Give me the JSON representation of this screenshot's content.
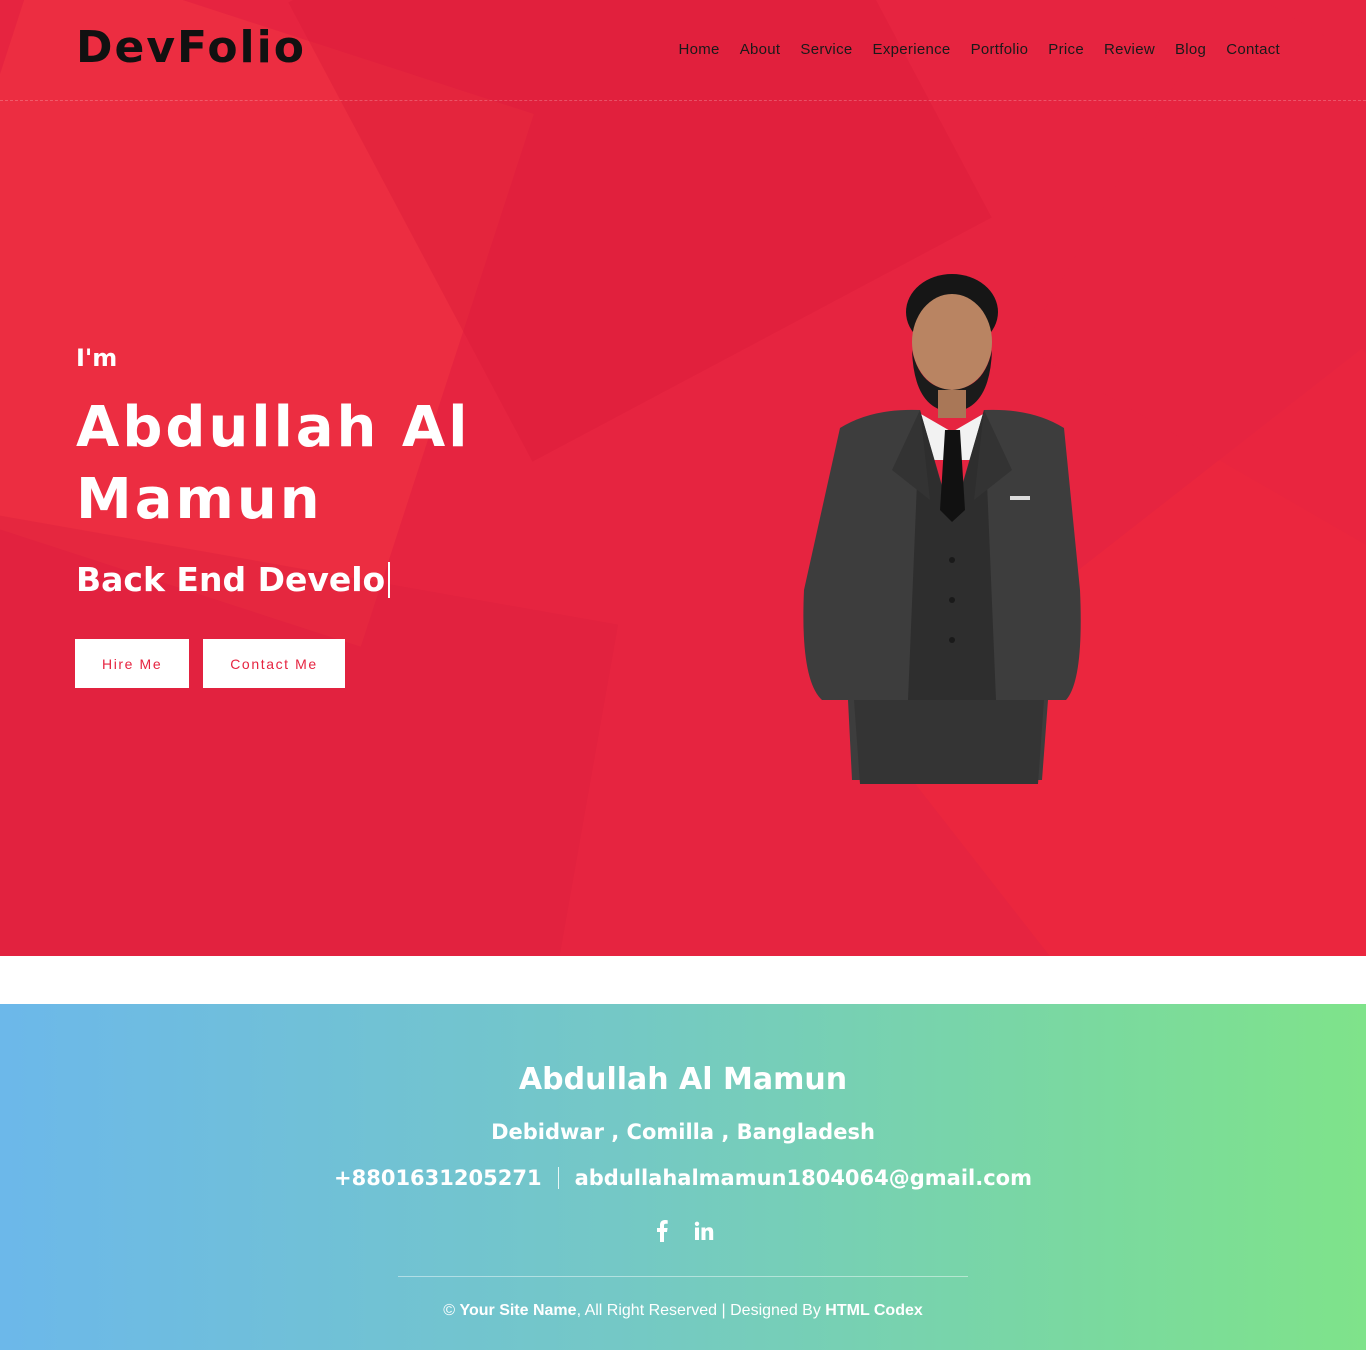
{
  "brand": {
    "logo": "DevFolio"
  },
  "nav": {
    "items": [
      {
        "label": "Home"
      },
      {
        "label": "About"
      },
      {
        "label": "Service"
      },
      {
        "label": "Experience"
      },
      {
        "label": "Portfolio"
      },
      {
        "label": "Price"
      },
      {
        "label": "Review"
      },
      {
        "label": "Blog"
      },
      {
        "label": "Contact"
      }
    ]
  },
  "hero": {
    "greeting": "I'm",
    "name": "Abdullah Al Mamun",
    "role_typed": "Back End Develo",
    "buttons": {
      "hire": "Hire Me",
      "contact": "Contact Me"
    },
    "image_icon": "person-portrait"
  },
  "footer": {
    "name": "Abdullah Al Mamun",
    "address": "Debidwar , Comilla , Bangladesh",
    "phone": "+8801631205271",
    "email": "abdullahalmamun1804064@gmail.com",
    "social": [
      {
        "icon": "facebook-icon"
      },
      {
        "icon": "linkedin-icon"
      }
    ],
    "copyright": {
      "symbol": "©",
      "site_name": "Your Site Name",
      "reserved": ", All Right Reserved | Designed By ",
      "designer": "HTML Codex"
    }
  },
  "colors": {
    "hero_bg": "#e62440",
    "button_text": "#e62440",
    "footer_gradient_start": "#6cb8ea",
    "footer_gradient_end": "#7fe38a"
  }
}
